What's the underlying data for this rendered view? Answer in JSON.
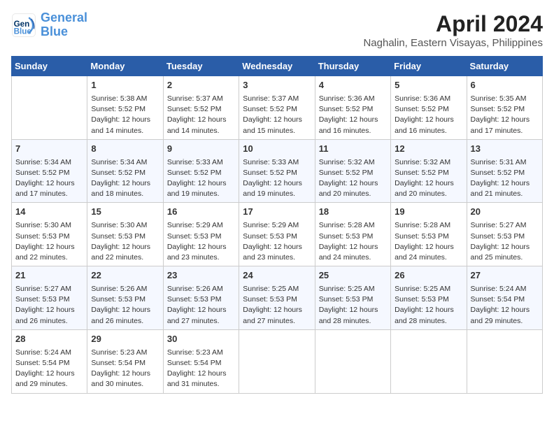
{
  "logo": {
    "line1": "General",
    "line2": "Blue"
  },
  "title": "April 2024",
  "subtitle": "Naghalin, Eastern Visayas, Philippines",
  "weekdays": [
    "Sunday",
    "Monday",
    "Tuesday",
    "Wednesday",
    "Thursday",
    "Friday",
    "Saturday"
  ],
  "weeks": [
    [
      {
        "day": "",
        "info": ""
      },
      {
        "day": "1",
        "info": "Sunrise: 5:38 AM\nSunset: 5:52 PM\nDaylight: 12 hours\nand 14 minutes."
      },
      {
        "day": "2",
        "info": "Sunrise: 5:37 AM\nSunset: 5:52 PM\nDaylight: 12 hours\nand 14 minutes."
      },
      {
        "day": "3",
        "info": "Sunrise: 5:37 AM\nSunset: 5:52 PM\nDaylight: 12 hours\nand 15 minutes."
      },
      {
        "day": "4",
        "info": "Sunrise: 5:36 AM\nSunset: 5:52 PM\nDaylight: 12 hours\nand 16 minutes."
      },
      {
        "day": "5",
        "info": "Sunrise: 5:36 AM\nSunset: 5:52 PM\nDaylight: 12 hours\nand 16 minutes."
      },
      {
        "day": "6",
        "info": "Sunrise: 5:35 AM\nSunset: 5:52 PM\nDaylight: 12 hours\nand 17 minutes."
      }
    ],
    [
      {
        "day": "7",
        "info": "Sunrise: 5:34 AM\nSunset: 5:52 PM\nDaylight: 12 hours\nand 17 minutes."
      },
      {
        "day": "8",
        "info": "Sunrise: 5:34 AM\nSunset: 5:52 PM\nDaylight: 12 hours\nand 18 minutes."
      },
      {
        "day": "9",
        "info": "Sunrise: 5:33 AM\nSunset: 5:52 PM\nDaylight: 12 hours\nand 19 minutes."
      },
      {
        "day": "10",
        "info": "Sunrise: 5:33 AM\nSunset: 5:52 PM\nDaylight: 12 hours\nand 19 minutes."
      },
      {
        "day": "11",
        "info": "Sunrise: 5:32 AM\nSunset: 5:52 PM\nDaylight: 12 hours\nand 20 minutes."
      },
      {
        "day": "12",
        "info": "Sunrise: 5:32 AM\nSunset: 5:52 PM\nDaylight: 12 hours\nand 20 minutes."
      },
      {
        "day": "13",
        "info": "Sunrise: 5:31 AM\nSunset: 5:52 PM\nDaylight: 12 hours\nand 21 minutes."
      }
    ],
    [
      {
        "day": "14",
        "info": "Sunrise: 5:30 AM\nSunset: 5:53 PM\nDaylight: 12 hours\nand 22 minutes."
      },
      {
        "day": "15",
        "info": "Sunrise: 5:30 AM\nSunset: 5:53 PM\nDaylight: 12 hours\nand 22 minutes."
      },
      {
        "day": "16",
        "info": "Sunrise: 5:29 AM\nSunset: 5:53 PM\nDaylight: 12 hours\nand 23 minutes."
      },
      {
        "day": "17",
        "info": "Sunrise: 5:29 AM\nSunset: 5:53 PM\nDaylight: 12 hours\nand 23 minutes."
      },
      {
        "day": "18",
        "info": "Sunrise: 5:28 AM\nSunset: 5:53 PM\nDaylight: 12 hours\nand 24 minutes."
      },
      {
        "day": "19",
        "info": "Sunrise: 5:28 AM\nSunset: 5:53 PM\nDaylight: 12 hours\nand 24 minutes."
      },
      {
        "day": "20",
        "info": "Sunrise: 5:27 AM\nSunset: 5:53 PM\nDaylight: 12 hours\nand 25 minutes."
      }
    ],
    [
      {
        "day": "21",
        "info": "Sunrise: 5:27 AM\nSunset: 5:53 PM\nDaylight: 12 hours\nand 26 minutes."
      },
      {
        "day": "22",
        "info": "Sunrise: 5:26 AM\nSunset: 5:53 PM\nDaylight: 12 hours\nand 26 minutes."
      },
      {
        "day": "23",
        "info": "Sunrise: 5:26 AM\nSunset: 5:53 PM\nDaylight: 12 hours\nand 27 minutes."
      },
      {
        "day": "24",
        "info": "Sunrise: 5:25 AM\nSunset: 5:53 PM\nDaylight: 12 hours\nand 27 minutes."
      },
      {
        "day": "25",
        "info": "Sunrise: 5:25 AM\nSunset: 5:53 PM\nDaylight: 12 hours\nand 28 minutes."
      },
      {
        "day": "26",
        "info": "Sunrise: 5:25 AM\nSunset: 5:53 PM\nDaylight: 12 hours\nand 28 minutes."
      },
      {
        "day": "27",
        "info": "Sunrise: 5:24 AM\nSunset: 5:54 PM\nDaylight: 12 hours\nand 29 minutes."
      }
    ],
    [
      {
        "day": "28",
        "info": "Sunrise: 5:24 AM\nSunset: 5:54 PM\nDaylight: 12 hours\nand 29 minutes."
      },
      {
        "day": "29",
        "info": "Sunrise: 5:23 AM\nSunset: 5:54 PM\nDaylight: 12 hours\nand 30 minutes."
      },
      {
        "day": "30",
        "info": "Sunrise: 5:23 AM\nSunset: 5:54 PM\nDaylight: 12 hours\nand 31 minutes."
      },
      {
        "day": "",
        "info": ""
      },
      {
        "day": "",
        "info": ""
      },
      {
        "day": "",
        "info": ""
      },
      {
        "day": "",
        "info": ""
      }
    ]
  ]
}
